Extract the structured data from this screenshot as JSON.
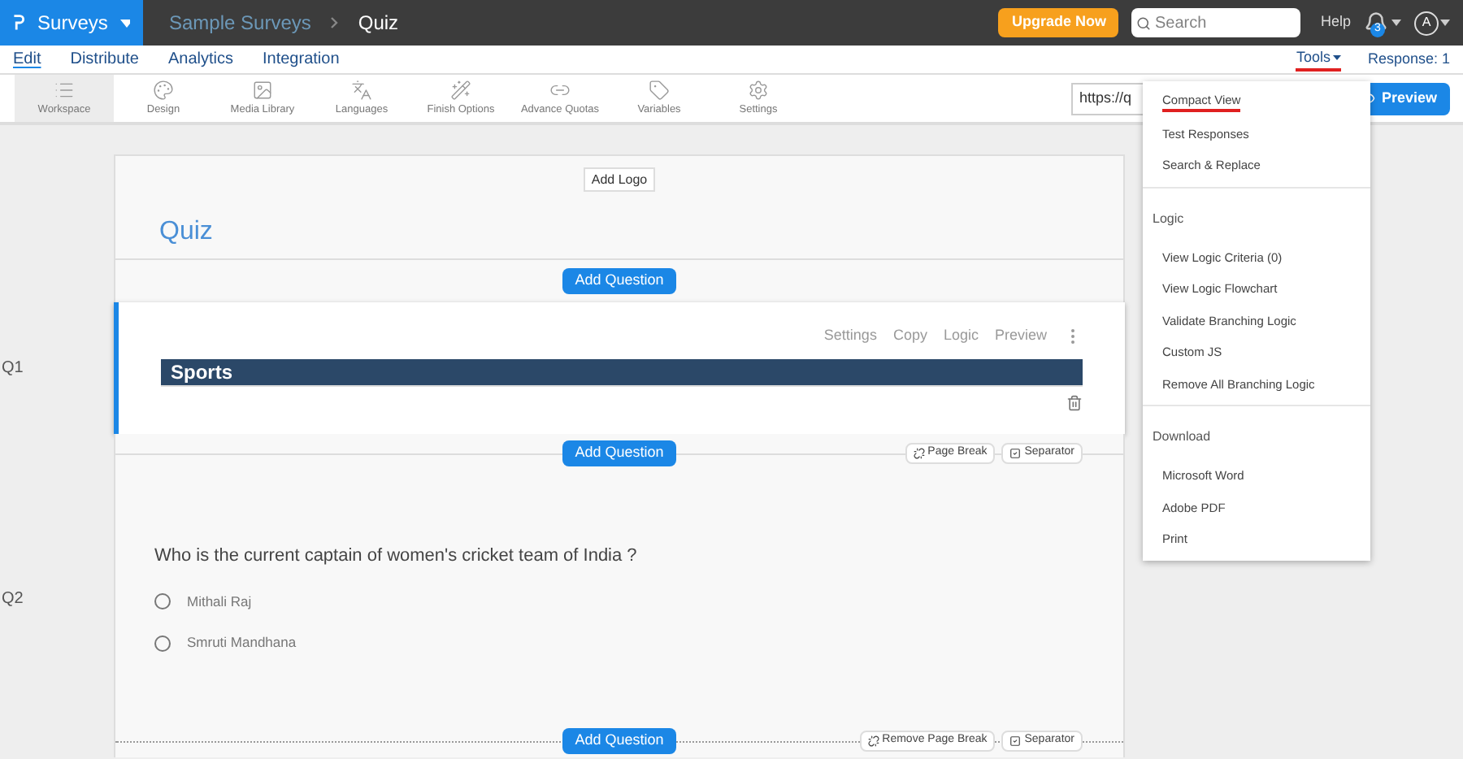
{
  "topbar": {
    "brand": "Surveys",
    "breadcrumbs": [
      "Sample Surveys",
      "Quiz"
    ],
    "upgrade": "Upgrade Now",
    "search": {
      "placeholder": "Search"
    },
    "help": "Help",
    "notifications": "3",
    "avatar": "A"
  },
  "nav": {
    "tabs": [
      {
        "label": "Edit",
        "selected": true
      },
      {
        "label": "Distribute",
        "selected": false
      },
      {
        "label": "Analytics",
        "selected": false
      },
      {
        "label": "Integration",
        "selected": false
      }
    ],
    "tools": "Tools",
    "response": "Response: 1"
  },
  "toolbar": {
    "items": [
      {
        "label": "Workspace",
        "selected": true
      },
      {
        "label": "Design",
        "selected": false
      },
      {
        "label": "Media Library",
        "selected": false
      },
      {
        "label": "Languages",
        "selected": false
      },
      {
        "label": "Finish Options",
        "selected": false
      },
      {
        "label": "Advance Quotas",
        "selected": false
      },
      {
        "label": "Variables",
        "selected": false
      },
      {
        "label": "Settings",
        "selected": false
      }
    ],
    "url": "https://q",
    "preview": "Preview"
  },
  "survey": {
    "add_logo": "Add Logo",
    "title": "Quiz",
    "add_question": "Add Question",
    "questions": [
      {
        "number": "Q1",
        "kind": "header",
        "text": "Sports",
        "actions": [
          "Settings",
          "Copy",
          "Logic",
          "Preview"
        ],
        "add_question": "Add Question",
        "page_break": "Page Break",
        "separator": "Separator"
      },
      {
        "number": "Q2",
        "kind": "choice",
        "text": "Who is the current captain of women's cricket team of India ?",
        "options": [
          {
            "label": "Mithali Raj",
            "selected": false
          },
          {
            "label": "Smruti Mandhana",
            "selected": false
          }
        ],
        "add_question": "Add Question",
        "page_break": "Remove Page Break",
        "separator": "Separator"
      }
    ]
  },
  "tools_menu": {
    "items": [
      {
        "kind": "item",
        "label": "Compact View",
        "selected": true
      },
      {
        "kind": "item",
        "label": "Test Responses",
        "selected": false
      },
      {
        "kind": "item",
        "label": "Search & Replace",
        "selected": false
      },
      {
        "kind": "section",
        "label": "Logic"
      },
      {
        "kind": "item",
        "label": "View Logic Criteria (0)",
        "selected": false
      },
      {
        "kind": "item",
        "label": "View Logic Flowchart",
        "selected": false
      },
      {
        "kind": "item",
        "label": "Validate Branching Logic",
        "selected": false
      },
      {
        "kind": "item",
        "label": "Custom JS",
        "selected": false
      },
      {
        "kind": "item",
        "label": "Remove All Branching Logic",
        "selected": false
      },
      {
        "kind": "section",
        "label": "Download"
      },
      {
        "kind": "item",
        "label": "Microsoft Word",
        "selected": false
      },
      {
        "kind": "item",
        "label": "Adobe PDF",
        "selected": false
      },
      {
        "kind": "item",
        "label": "Print",
        "selected": false
      }
    ]
  }
}
